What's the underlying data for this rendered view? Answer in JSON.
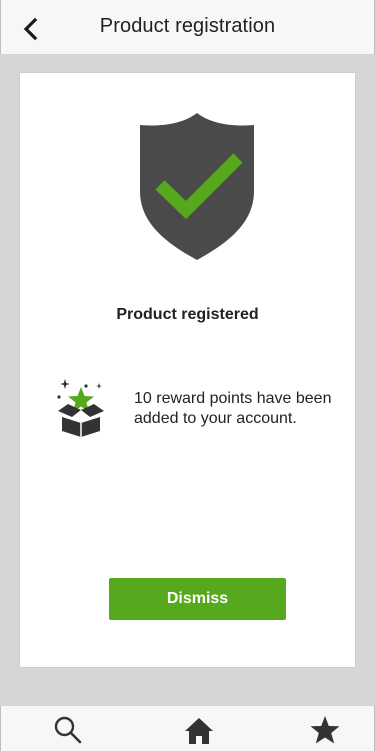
{
  "header": {
    "title": "Product registration",
    "back_icon": "chevron-left-icon"
  },
  "confirmation": {
    "shield_icon": "shield-check-icon",
    "heading": "Product registered",
    "reward_icon": "gift-box-star-icon",
    "reward_message": "10 reward points have been added to your account.",
    "dismiss_label": "Dismiss"
  },
  "tabbar": {
    "items": [
      {
        "icon": "search-icon"
      },
      {
        "icon": "home-icon"
      },
      {
        "icon": "star-icon"
      }
    ]
  },
  "colors": {
    "accent_green": "#56a81d",
    "shield_dark": "#4a4a4a",
    "background": "#d6d6d6"
  }
}
